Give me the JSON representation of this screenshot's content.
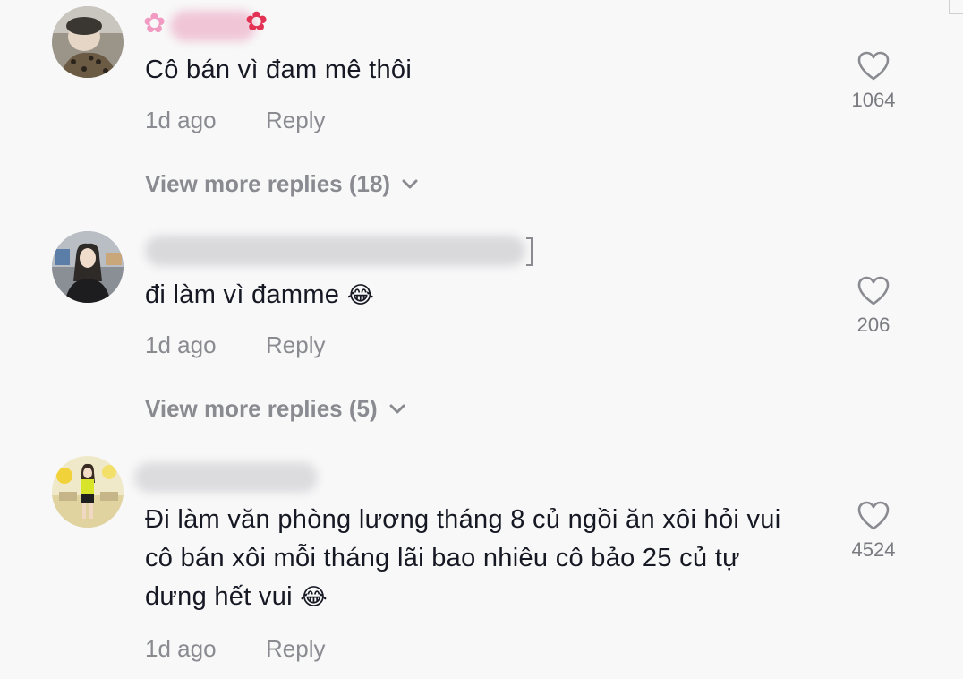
{
  "comments": [
    {
      "username": "",
      "text": "Cô bán vì đam mê thôi",
      "emoji": "",
      "time": "1d ago",
      "reply_label": "Reply",
      "likes": "1064",
      "view_more": "View more replies (18)"
    },
    {
      "username": "",
      "text": "đi làm vì đamme",
      "emoji": "😂",
      "time": "1d ago",
      "reply_label": "Reply",
      "likes": "206",
      "view_more": "View more replies (5)"
    },
    {
      "username": "",
      "text": "Đi làm văn phòng lương tháng 8 củ ngồi ăn xôi hỏi vui cô bán xôi mỗi tháng lãi bao nhiêu cô bảo 25 củ tự dưng hết vui",
      "emoji": "😂",
      "time": "1d ago",
      "reply_label": "Reply",
      "likes": "4524"
    }
  ],
  "icons": {
    "like": "heart-outline-icon",
    "expand": "chevron-down-icon"
  },
  "colors": {
    "background": "#f8f8f8",
    "text": "#161823",
    "muted": "#8a8b91"
  }
}
